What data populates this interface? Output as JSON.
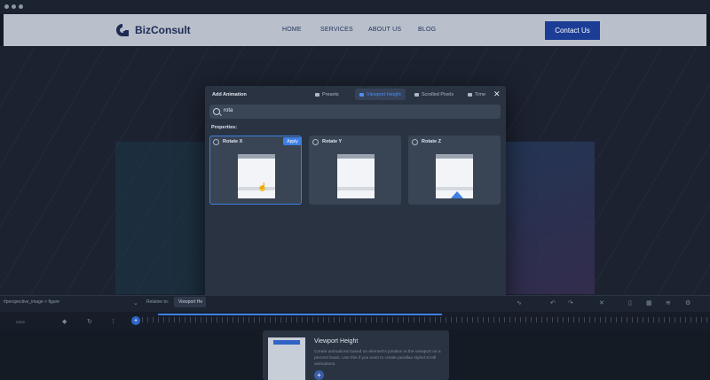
{
  "site": {
    "brand": "BizConsult",
    "nav": [
      "HOME",
      "SERVICES",
      "ABOUT US",
      "BLOG"
    ],
    "cta": "Contact Us",
    "brand_color": "#1c3d95"
  },
  "modal": {
    "title": "Add Animation",
    "tabs": [
      {
        "label": "Presets",
        "active": false
      },
      {
        "label": "Viewport Height",
        "active": true
      },
      {
        "label": "Scrolled Pixels",
        "active": false
      },
      {
        "label": "Time",
        "active": false
      }
    ],
    "search_value": "rota",
    "properties_label": "Properties:",
    "cards": [
      {
        "label": "Rotate X",
        "selected": true,
        "apply": "Apply"
      },
      {
        "label": "Rotate Y",
        "selected": false
      },
      {
        "label": "Rotate Z",
        "selected": false
      }
    ],
    "accent": "#3d7fe3"
  },
  "editor": {
    "selector": "#perspective_image > figure",
    "relative_label": "Relative to:",
    "relative_value": "Viewport He",
    "timeline_label": "none"
  },
  "info_card": {
    "title": "Viewport Height",
    "description": "Create animations based on element's position in the viewport on a percent basis. Use this if you want to create parallax styled scroll animations."
  }
}
